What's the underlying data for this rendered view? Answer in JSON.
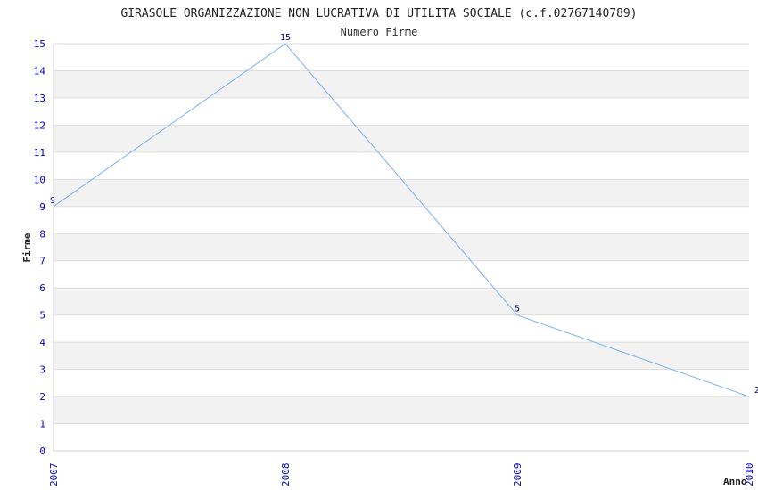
{
  "chart_data": {
    "type": "line",
    "title": "GIRASOLE ORGANIZZAZIONE NON LUCRATIVA DI UTILITA SOCIALE (c.f.02767140789)",
    "subtitle": "Numero Firme",
    "xlabel": "Anno",
    "ylabel": "Firme",
    "categories": [
      "2007",
      "2008",
      "2009",
      "2010"
    ],
    "series": [
      {
        "values": [
          9,
          15,
          5,
          2
        ]
      }
    ],
    "ylim": [
      0,
      15
    ],
    "yticks": [
      "0",
      "1",
      "2",
      "3",
      "4",
      "5",
      "6",
      "7",
      "8",
      "9",
      "10",
      "11",
      "12",
      "13",
      "14",
      "15"
    ],
    "grid": true,
    "colors": {
      "line": "#77b0ee",
      "band": "#f2f2f2",
      "gridline": "#dddddd",
      "ticks": "#0000cc",
      "labels": "#000088"
    }
  }
}
